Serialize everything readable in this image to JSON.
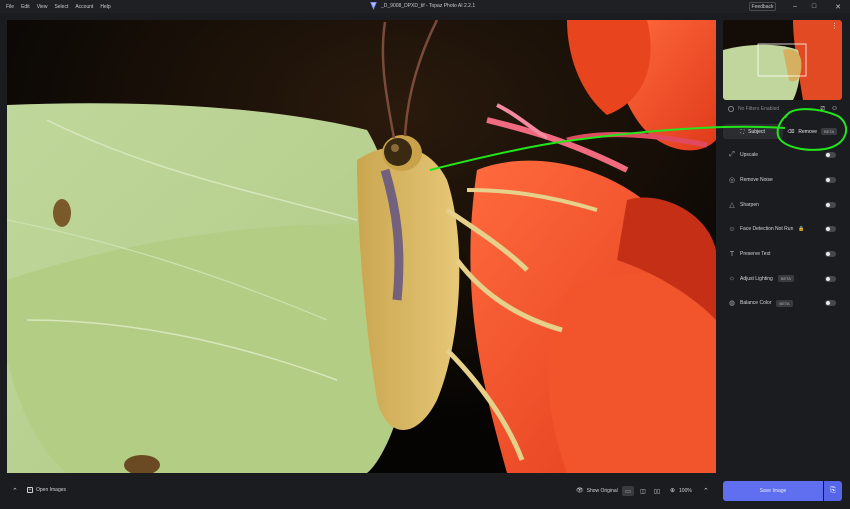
{
  "menu": [
    "File",
    "Edit",
    "View",
    "Select",
    "Account",
    "Help"
  ],
  "window": {
    "title": "_D_9008_DPXD_tif - Topaz Photo AI 2.2.1",
    "feedback_label": "Feedback",
    "minimize": "–",
    "maximize": "□",
    "close": "✕"
  },
  "panel": {
    "more_icon": "⋮",
    "filters_status": "No Filters Enabled",
    "crop_icon": "⧄",
    "face_icon": "☺",
    "subject_label": "Subject",
    "remove_label": "Remove",
    "remove_badge": "BETA",
    "filters": [
      {
        "label": "Upscale",
        "icon": "⤢",
        "badge": "",
        "lock": false
      },
      {
        "label": "Remove Noise",
        "icon": "◎",
        "badge": "",
        "lock": false
      },
      {
        "label": "Sharpen",
        "icon": "△",
        "badge": "",
        "lock": false
      },
      {
        "label": "Face Detection Not Run",
        "icon": "☺",
        "badge": "",
        "lock": true
      },
      {
        "label": "Preserve Text",
        "icon": "T",
        "badge": "",
        "lock": false
      },
      {
        "label": "Adjust Lighting",
        "icon": "☼",
        "badge": "BETA",
        "lock": false
      },
      {
        "label": "Balance Color",
        "icon": "◍",
        "badge": "BETA",
        "lock": false
      }
    ]
  },
  "bottom": {
    "collapse_icon": "⌃",
    "open_images_label": "Open Images",
    "show_original_label": "Show Original",
    "zoom_label": "100%",
    "zoom_caret": "⌃",
    "save_label": "Save Image"
  },
  "colors": {
    "accent": "#5f6ff0",
    "annotation": "#22e61b"
  }
}
